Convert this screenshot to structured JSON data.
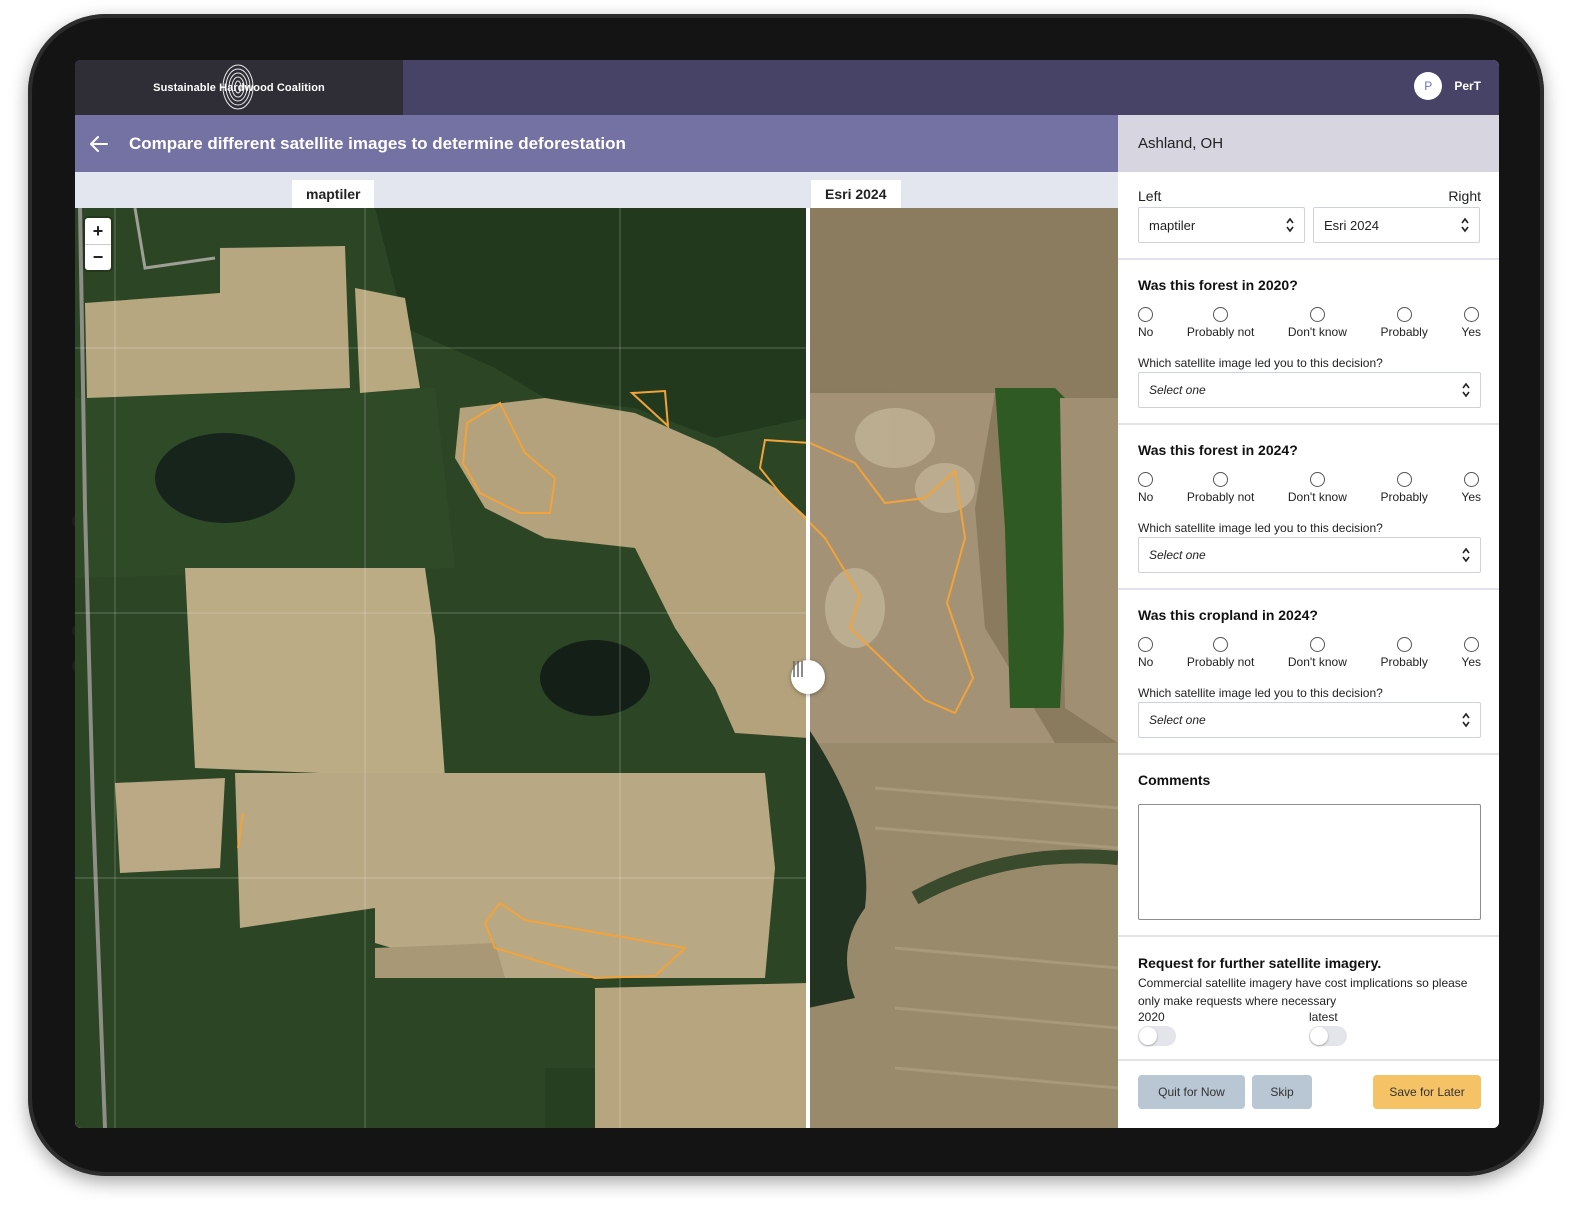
{
  "app": {
    "brand": "Sustainable Hardwood Coalition",
    "user_initial": "P",
    "user_name": "PerT"
  },
  "header": {
    "title": "Compare different satellite images to determine deforestation"
  },
  "compare": {
    "left_label": "maptiler",
    "right_label": "Esri 2024"
  },
  "map": {
    "zoom_in": "+",
    "zoom_out": "−"
  },
  "panel": {
    "location": "Ashland, OH",
    "left_caption": "Left",
    "right_caption": "Right",
    "left_source": "maptiler",
    "right_source": "Esri 2024",
    "questions": [
      {
        "title": "Was this forest in 2020?",
        "options": [
          "No",
          "Probably not",
          "Don't know",
          "Probably",
          "Yes"
        ],
        "sub_question": "Which satellite image led you to this decision?",
        "select_placeholder": "Select one"
      },
      {
        "title": "Was this forest in 2024?",
        "options": [
          "No",
          "Probably not",
          "Don't know",
          "Probably",
          "Yes"
        ],
        "sub_question": "Which satellite image led you to this decision?",
        "select_placeholder": "Select one"
      },
      {
        "title": "Was this cropland in 2024?",
        "options": [
          "No",
          "Probably not",
          "Don't know",
          "Probably",
          "Yes"
        ],
        "sub_question": "Which satellite image led you to this decision?",
        "select_placeholder": "Select one"
      }
    ],
    "comments_label": "Comments",
    "comments_value": "",
    "request": {
      "title": "Request for further satellite imagery.",
      "note": "Commercial satellite imagery have cost implications so please only make requests where necessary",
      "toggle_2020_label": "2020",
      "toggle_latest_label": "latest",
      "toggle_2020_on": false,
      "toggle_latest_on": false
    },
    "buttons": {
      "quit": "Quit for Now",
      "skip": "Skip",
      "save": "Save for Later"
    }
  },
  "colors": {
    "topbar": "#464366",
    "titlebar": "#7472a3",
    "polygon": "#f2a33a",
    "save_button": "#f5c265",
    "grey_button": "#b9c6d3"
  }
}
